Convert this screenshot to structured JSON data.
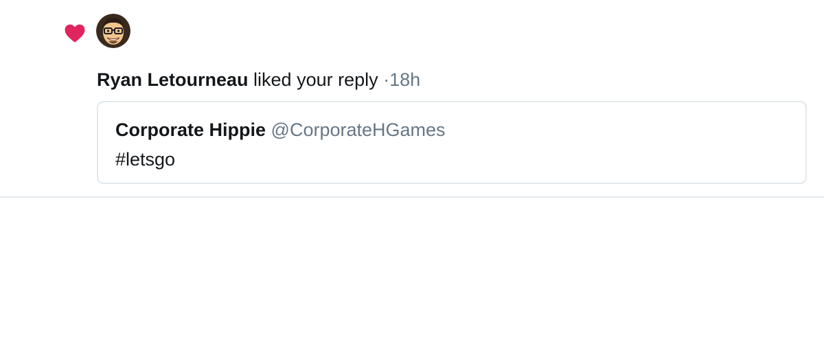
{
  "notification": {
    "icon": "heart-icon",
    "icon_color": "#e0245e",
    "avatar": "user-avatar-cartoon-face",
    "user_name": "Ryan Letourneau",
    "action_text": " liked your reply",
    "time": " ·18h",
    "tweet": {
      "author_name": "Corporate Hippie",
      "author_handle": " @CorporateHGames",
      "text": "#letsgo"
    }
  }
}
